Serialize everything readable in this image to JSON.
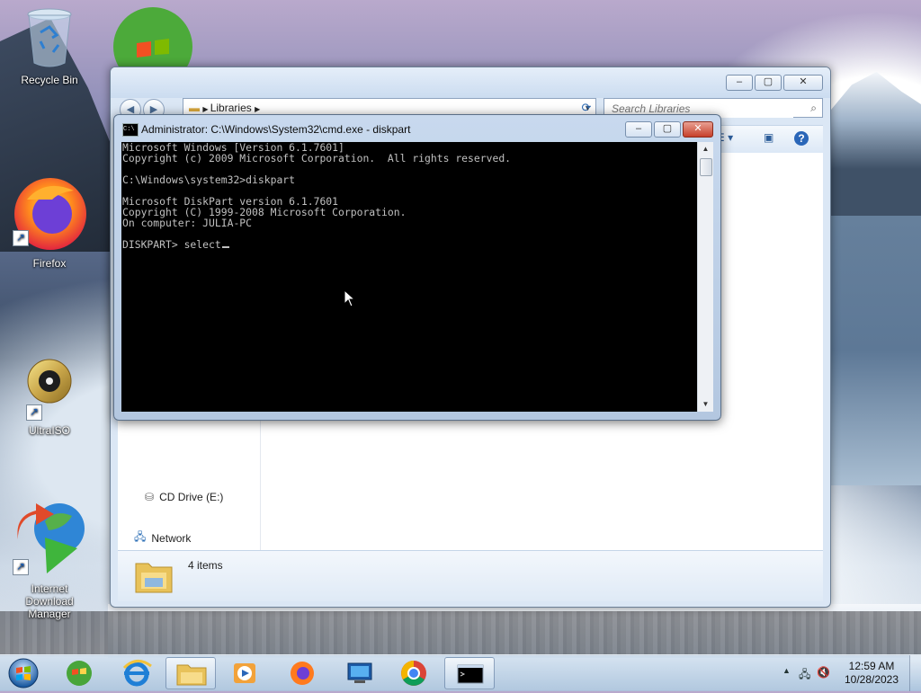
{
  "desktop": {
    "icons": [
      {
        "label": "Recycle Bin"
      },
      {
        "label": "Firefox"
      },
      {
        "label": "UltraISO"
      },
      {
        "label": "Internet Download Manager"
      }
    ]
  },
  "explorer": {
    "address_path": "Libraries",
    "search_placeholder": "Search Libraries",
    "nav_items": [
      "CD Drive (E:)",
      "Network"
    ],
    "status_count": "4 items",
    "window_buttons": {
      "minimize": "–",
      "maximize": "▢",
      "close": "✕"
    }
  },
  "cmd": {
    "title": "Administrator: C:\\Windows\\System32\\cmd.exe - diskpart",
    "icon_text": "C:\\",
    "lines": [
      "Microsoft Windows [Version 6.1.7601]",
      "Copyright (c) 2009 Microsoft Corporation.  All rights reserved.",
      "",
      "C:\\Windows\\system32>diskpart",
      "",
      "Microsoft DiskPart version 6.1.7601",
      "Copyright (C) 1999-2008 Microsoft Corporation.",
      "On computer: JULIA-PC",
      ""
    ],
    "prompt": "DISKPART> select",
    "window_buttons": {
      "minimize": "–",
      "maximize": "▢",
      "close": "✕"
    }
  },
  "taskbar": {
    "apps": [
      "windows-media-center",
      "internet-explorer",
      "windows-explorer",
      "media-player",
      "firefox",
      "remote-desktop",
      "chrome",
      "cmd"
    ],
    "active_app": "windows-explorer",
    "clock_time": "12:59 AM",
    "clock_date": "10/28/2023"
  },
  "colors": {
    "console_bg": "#000000",
    "console_fg": "#c0c0c0",
    "aero_frame": "#c8d9ee",
    "close_red": "#c7402a"
  }
}
